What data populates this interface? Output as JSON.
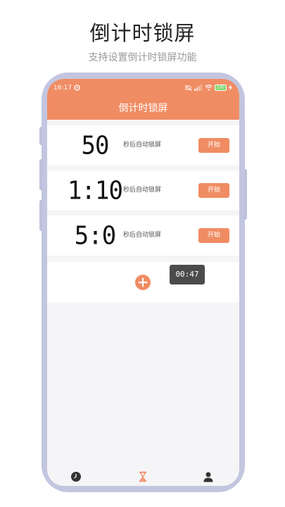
{
  "promo": {
    "title": "倒计时锁屏",
    "subtitle": "支持设置倒计时锁屏功能"
  },
  "status_bar": {
    "time": "16:17",
    "battery": "100",
    "icons": [
      "settings-icon",
      "mute-icon",
      "signal-icon",
      "wifi-icon",
      "battery-icon",
      "charging-icon"
    ]
  },
  "header": {
    "title": "倒计时锁屏"
  },
  "timers": [
    {
      "display": "50",
      "label": "秒后自动锁屏",
      "button": "开始"
    },
    {
      "display": "1:10",
      "label": "秒后自动锁屏",
      "button": "开始"
    },
    {
      "display": "5:0",
      "label": "秒后自动锁屏",
      "button": "开始"
    }
  ],
  "toast": {
    "text": "00:47"
  },
  "tabs": [
    {
      "name": "clock",
      "icon": "clock-icon",
      "active": false
    },
    {
      "name": "hourglass",
      "icon": "hourglass-icon",
      "active": true
    },
    {
      "name": "profile",
      "icon": "person-icon",
      "active": false
    }
  ],
  "colors": {
    "accent": "#f08c63",
    "phone_frame": "#c3c6df",
    "toast_bg": "#4b4b4b"
  }
}
